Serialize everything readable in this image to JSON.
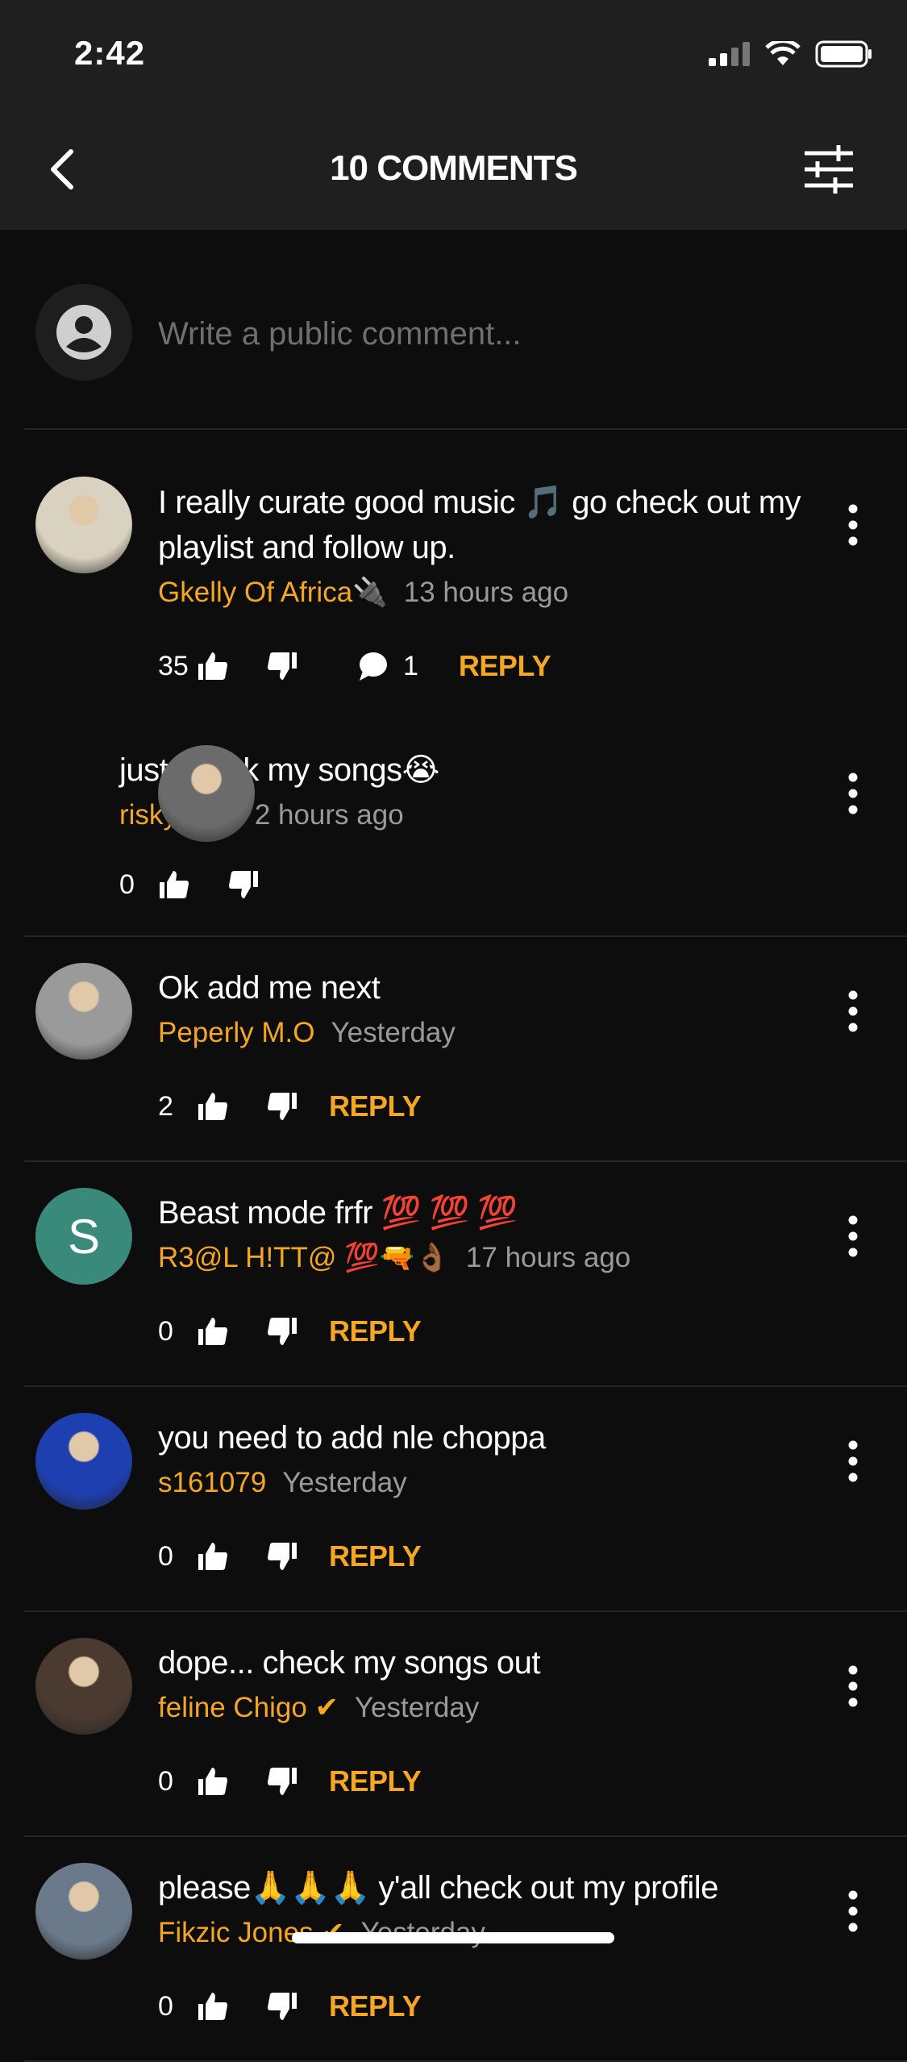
{
  "status_bar": {
    "time": "2:42",
    "icons": [
      "cellular-signal-icon",
      "wifi-icon",
      "battery-icon"
    ]
  },
  "header": {
    "title": "10 COMMENTS",
    "back_icon": "chevron-left-icon",
    "filter_icon": "sliders-icon"
  },
  "composer": {
    "placeholder": "Write a public comment...",
    "avatar_icon": "user-circle-icon"
  },
  "colors": {
    "accent": "#f5a623",
    "background": "#0d0d0d",
    "header": "#1f1f1f",
    "meta": "#9a9a9a"
  },
  "reply_label": "REPLY",
  "comments": [
    {
      "text": "I really curate good music 🎵 go check out my playlist and follow up.",
      "author": "Gkelly Of Africa🔌",
      "time": "13 hours ago",
      "likes": "35",
      "replies": "1",
      "avatar": "photo",
      "avatar_color": "#d9d2c0",
      "reply_items": [
        {
          "text": "just check my songs😭",
          "author": "risky tuch",
          "time": "2 hours ago",
          "likes": "0",
          "avatar": "photo",
          "avatar_color": "#6b6b6b"
        }
      ]
    },
    {
      "text": "Ok add me next",
      "author": "Peperly M.O",
      "time": "Yesterday",
      "likes": "2",
      "avatar": "photo",
      "avatar_color": "#9a9a9a"
    },
    {
      "text": "Beast mode frfr 💯 💯 💯",
      "author": "R3@L H!TT@ 💯🔫👌🏾",
      "time": "17 hours ago",
      "likes": "0",
      "avatar": "letter",
      "avatar_letter": "S",
      "avatar_color": "#3a8a7c"
    },
    {
      "text": "you need to add nle choppa",
      "author": "s161079",
      "time": "Yesterday",
      "likes": "0",
      "avatar": "photo",
      "avatar_color": "#1e3fb0"
    },
    {
      "text": "dope... check my songs out",
      "author": "feline Chigo ✔",
      "time": "Yesterday",
      "likes": "0",
      "avatar": "photo",
      "avatar_color": "#4a3a30"
    },
    {
      "text": "please🙏🙏🙏 y'all check out my profile",
      "author": "Fikzic Jones ✔",
      "time": "Yesterday",
      "likes": "0",
      "avatar": "photo",
      "avatar_color": "#6a7a8a"
    }
  ]
}
